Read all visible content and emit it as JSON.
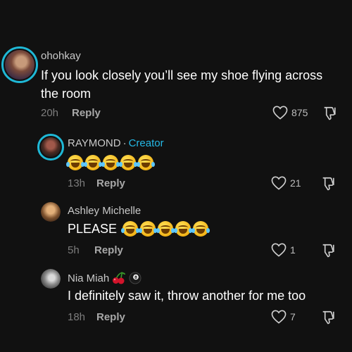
{
  "comments": [
    {
      "username": "ohohkay",
      "text": "If you look closely you’ll see my shoe flying across the room",
      "time": "20h",
      "reply_label": "Reply",
      "likes": "875",
      "has_story_ring": true
    },
    {
      "username": "RAYMOND",
      "separator": "·",
      "creator_badge": "Creator",
      "emoji": "laughing-with-tears-emoji x5",
      "time": "13h",
      "reply_label": "Reply",
      "likes": "21",
      "has_story_ring": true
    },
    {
      "username": "Ashley Michelle",
      "text": "PLEASE",
      "emoji": "laughing-with-tears-emoji x5",
      "time": "5h",
      "reply_label": "Reply",
      "likes": "1"
    },
    {
      "username": "Nia Miah",
      "username_emoji": [
        "cherries-emoji",
        "8-ball-emoji"
      ],
      "text": "I definitely saw it, throw another for me too",
      "time": "18h",
      "reply_label": "Reply",
      "likes": "7"
    }
  ],
  "colors": {
    "background": "#111111",
    "story_ring": "#1fb8d6",
    "creator_label": "#25b9e6",
    "muted_text": "#7d7d7d"
  }
}
